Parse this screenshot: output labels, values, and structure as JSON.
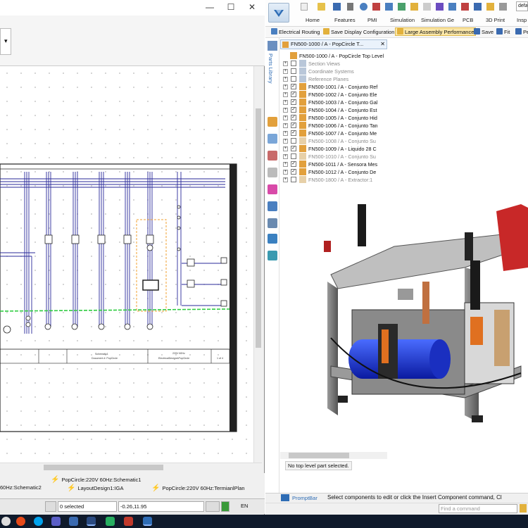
{
  "left_window": {
    "controls": {
      "minimize": "—",
      "maximize": "☐",
      "close": "✕"
    },
    "dropdown_arrow": "▾",
    "doc_tabs": [
      {
        "label": "PopCircle:220V 60Hz:Schematic1"
      },
      {
        "label": "60Hz:Schematic2"
      },
      {
        "label": "LayoutDesign1:IGA"
      },
      {
        "label": "PopCircle:220V 60Hz:TermianlPlan"
      }
    ],
    "status": {
      "selected": "0 selected",
      "coords": "-0.26,11.95",
      "lang": "EN"
    },
    "schematic": {
      "title_block": [
        "Schematic1",
        "Document #: PopCircle",
        "220V 60Hz",
        "ElectricalDesigns\\PopCircle",
        "1 of 4"
      ]
    }
  },
  "right_window": {
    "ribbon_tabs": [
      "Home",
      "Features",
      "PMI",
      "Simulation",
      "Simulation Ge",
      "PCB",
      "3D Print",
      "Insp"
    ],
    "ribbon_top_items": [
      "defa"
    ],
    "quick_access": [
      {
        "label": "Electrical Routing",
        "color": "#4a7fc0"
      },
      {
        "label": "Save Display Configuration",
        "color": "#e2b13c"
      },
      {
        "label": "Large Assembly Performance",
        "color": "#e2b13c"
      },
      {
        "label": "Save",
        "color": "#3a6ab0"
      },
      {
        "label": "Fit",
        "color": "#3a6ab0"
      },
      {
        "label": "Pe",
        "color": "#3a6ab0"
      }
    ],
    "side_label": "Parts Library",
    "tree_tab": {
      "label": "FN500-1000 / A - PopCircle T...",
      "close": "✕"
    },
    "tree": {
      "root": "FN500-1000 / A - PopCircle Top Level",
      "items": [
        {
          "label": "Section Views",
          "checked": false,
          "dim": true,
          "kind": "folder"
        },
        {
          "label": "Coordinate Systems",
          "checked": false,
          "dim": true,
          "kind": "folder"
        },
        {
          "label": "Reference Planes",
          "checked": false,
          "dim": true,
          "kind": "folder"
        },
        {
          "label": "FN500-1001 / A - Conjunto Ref",
          "checked": true,
          "dim": false,
          "kind": "asm"
        },
        {
          "label": "FN500-1002 / A - Conjunto Ele",
          "checked": true,
          "dim": false,
          "kind": "asm"
        },
        {
          "label": "FN500-1003 / A - Conjunto Gal",
          "checked": true,
          "dim": false,
          "kind": "asm"
        },
        {
          "label": "FN500-1004 / A - Conjunto Est",
          "checked": true,
          "dim": false,
          "kind": "asm"
        },
        {
          "label": "FN500-1005 / A - Conjunto Hid",
          "checked": true,
          "dim": false,
          "kind": "asm"
        },
        {
          "label": "FN500-1006 / A - Conjunto Tan",
          "checked": true,
          "dim": false,
          "kind": "asm"
        },
        {
          "label": "FN500-1007 / A - Conjunto Me",
          "checked": true,
          "dim": false,
          "kind": "asm"
        },
        {
          "label": "FN500-1008 / A - Conjunto Su",
          "checked": false,
          "dim": true,
          "kind": "asm"
        },
        {
          "label": "FN500-1009 / A - Liquido 28 C",
          "checked": true,
          "dim": false,
          "kind": "asm"
        },
        {
          "label": "FN500-1010 / A - Conjunto Su",
          "checked": false,
          "dim": true,
          "kind": "asm"
        },
        {
          "label": "FN500-1011 / A - Sensora Mes",
          "checked": true,
          "dim": false,
          "kind": "asm"
        },
        {
          "label": "FN500-1012 / A - Conjunto De",
          "checked": true,
          "dim": false,
          "kind": "asm"
        },
        {
          "label": "FN500-1800 / A - Extractor:1",
          "checked": false,
          "dim": true,
          "kind": "asm"
        }
      ]
    },
    "no_part_message": "No top level part selected.",
    "prompt_bar": {
      "label": "PromptBar",
      "message": "Select components to edit or click the Insert Component command, Cl"
    },
    "command_placeholder": "Find a command"
  },
  "colors": {
    "accent": "#2f6db5",
    "taskbar": "#0f1a2b",
    "schematic_line": "#2a2a9a",
    "ground_line": "#2ecc40"
  }
}
